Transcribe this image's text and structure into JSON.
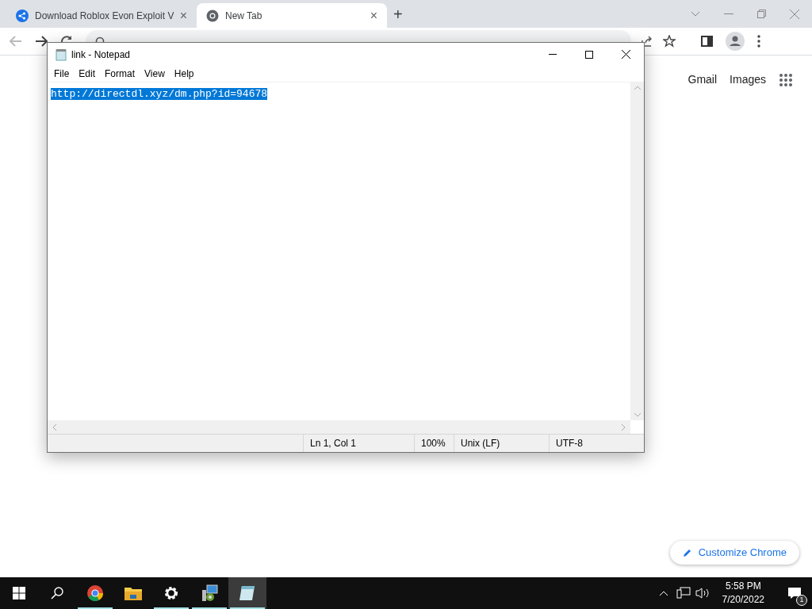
{
  "browser": {
    "tabs": [
      {
        "title": "Download Roblox Evon Exploit V",
        "close": "×",
        "selected": false
      },
      {
        "title": "New Tab",
        "close": "×",
        "selected": true
      }
    ],
    "new_tab": "+",
    "links": [
      "Gmail",
      "Images"
    ],
    "customize": "Customize Chrome"
  },
  "notepad": {
    "title": "link - Notepad",
    "menu": [
      "File",
      "Edit",
      "Format",
      "View",
      "Help"
    ],
    "text": "http://directdl.xyz/dm.php?id=94678",
    "selected_text": true,
    "status": [
      "Ln 1, Col 1",
      "100%",
      "Unix (LF)",
      "UTF-8"
    ]
  },
  "taskbar": {
    "apps": [
      {
        "kind": "chrome",
        "running": true,
        "selected": false
      },
      {
        "kind": "folder",
        "running": false,
        "selected": false
      },
      {
        "kind": "gear",
        "running": true,
        "selected": false
      },
      {
        "kind": "installer",
        "running": true,
        "selected": false
      },
      {
        "kind": "notepad",
        "running": true,
        "selected": true
      }
    ],
    "time": "5:58 PM",
    "date": "7/20/2022",
    "notifications": "1"
  }
}
